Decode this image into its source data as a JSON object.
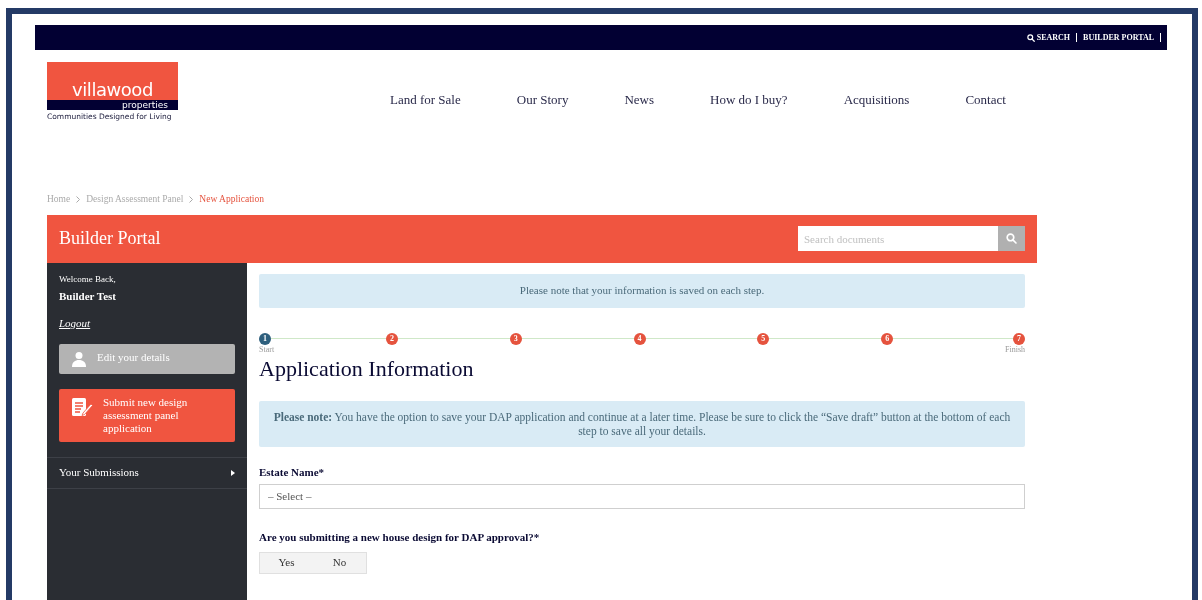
{
  "top_bar": {
    "links": [
      {
        "label": "SEARCH",
        "kind": "search"
      },
      {
        "label": "BUILDER PORTAL",
        "kind": "plain"
      }
    ]
  },
  "logo": {
    "name": "villawood",
    "sub": "properties",
    "tagline": "Communities Designed for Living"
  },
  "nav": [
    "Land for Sale",
    "Our Story",
    "News",
    "How do I buy?",
    "Acquisitions",
    "Contact"
  ],
  "breadcrumb": [
    {
      "label": "Home",
      "selected": false
    },
    {
      "label": "Design Assessment Panel",
      "selected": false
    },
    {
      "label": "New Application",
      "selected": true
    }
  ],
  "portal": {
    "title": "Builder Portal",
    "search": {
      "placeholder": "Search documents"
    }
  },
  "sidebar": {
    "welcome": "Welcome Back,",
    "user": "Builder Test",
    "logout": "Logout",
    "buttons": [
      {
        "label": "Edit your details",
        "kind": "person"
      },
      {
        "label": "Submit new design assessment panel application",
        "kind": "form"
      }
    ],
    "menu": [
      {
        "label": "Your Submissions"
      }
    ]
  },
  "notice": "Please note that your information is saved on each step.",
  "steps": [
    {
      "number": "1",
      "current": true,
      "label": "Start"
    },
    {
      "number": "2",
      "current": false
    },
    {
      "number": "3",
      "current": false
    },
    {
      "number": "4",
      "current": false
    },
    {
      "number": "5",
      "current": false
    },
    {
      "number": "6",
      "current": false
    },
    {
      "number": "7",
      "current": false,
      "label": "Finish"
    }
  ],
  "heading": "Application Information",
  "info": "**Please note:** You have the option to save your DAP application and continue at a later time. Please be sure to click the “Save draft” button at the bottom of each step to save all your details.",
  "form": {
    "estate": {
      "label": "Estate Name*",
      "placeholder": "– Select –"
    },
    "question": {
      "label": "Are you submitting a new house design for DAP approval?*",
      "options": [
        {
          "label": "Yes",
          "selected": false
        },
        {
          "label": "No",
          "selected": false
        }
      ]
    }
  }
}
